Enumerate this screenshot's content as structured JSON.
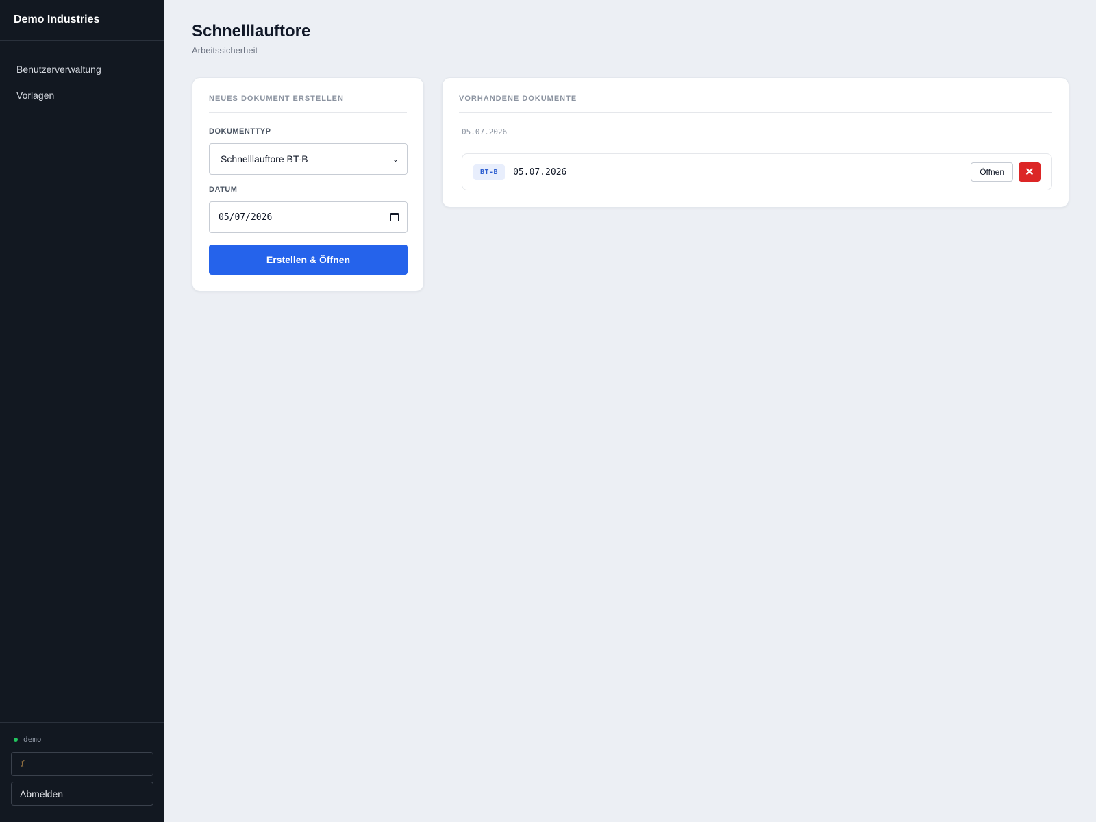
{
  "app": {
    "brand": "Demo Industries"
  },
  "sidebar": {
    "items": [
      {
        "label": "Benutzerverwaltung"
      },
      {
        "label": "Vorlagen"
      }
    ],
    "user": "demo",
    "theme_icon": "moon-icon",
    "logout_label": "Abmelden"
  },
  "page": {
    "title": "Schnelllauftore",
    "subtitle": "Arbeitssicherheit"
  },
  "create": {
    "heading": "NEUES DOKUMENT ERSTELLEN",
    "type_label": "DOKUMENTTYP",
    "type_value": "Schnelllauftore BT-B",
    "date_label": "DATUM",
    "date_value": "05/07/2026",
    "submit_label": "Erstellen & Öffnen"
  },
  "documents": {
    "heading": "VORHANDENE DOKUMENTE",
    "groups": [
      {
        "date": "05.07.2026",
        "items": [
          {
            "badge": "BT-B",
            "date": "05.07.2026",
            "open_label": "Öffnen",
            "delete_icon": "close-icon"
          }
        ]
      }
    ]
  },
  "colors": {
    "sidebar_bg": "#121821",
    "primary": "#2563eb",
    "danger": "#dc2626",
    "status_online": "#22c55e"
  }
}
